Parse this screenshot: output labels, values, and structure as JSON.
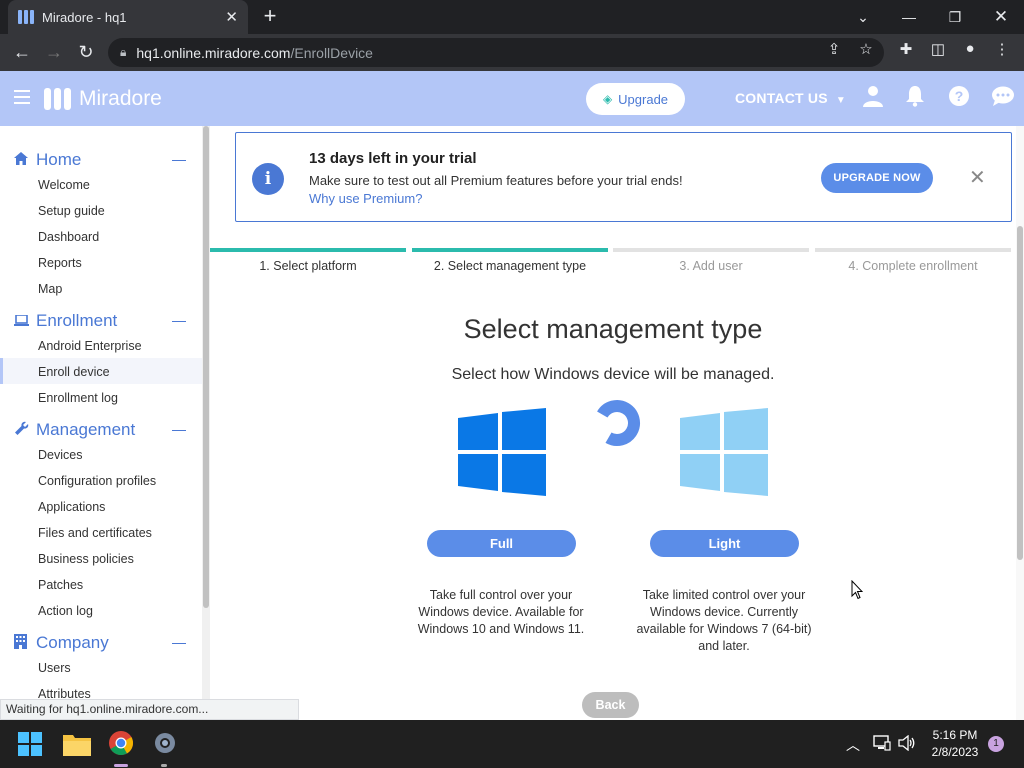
{
  "browser": {
    "tab_title": "Miradore - hq1",
    "url_host": "hq1.online.miradore.com",
    "url_path": "/EnrollDevice",
    "status_text": "Waiting for hq1.online.miradore.com..."
  },
  "header": {
    "brand": "Miradore",
    "upgrade_label": "Upgrade",
    "contact_label": "CONTACT US"
  },
  "sidebar": {
    "sections": [
      {
        "label": "Home",
        "icon": "home-icon",
        "items": [
          "Welcome",
          "Setup guide",
          "Dashboard",
          "Reports",
          "Map"
        ]
      },
      {
        "label": "Enrollment",
        "icon": "laptop-icon",
        "items": [
          "Android Enterprise",
          "Enroll device",
          "Enrollment log"
        ]
      },
      {
        "label": "Management",
        "icon": "wrench-icon",
        "items": [
          "Devices",
          "Configuration profiles",
          "Applications",
          "Files and certificates",
          "Business policies",
          "Patches",
          "Action log"
        ]
      },
      {
        "label": "Company",
        "icon": "building-icon",
        "items": [
          "Users",
          "Attributes"
        ]
      }
    ],
    "active_item": "Enroll device"
  },
  "trial": {
    "title": "13 days left in your trial",
    "text": "Make sure to test out all Premium features before your trial ends!",
    "link": "Why use Premium?",
    "button": "UPGRADE NOW"
  },
  "steps": [
    {
      "label": "1. Select platform",
      "state": "done"
    },
    {
      "label": "2. Select management type",
      "state": "done"
    },
    {
      "label": "3. Add user",
      "state": "todo"
    },
    {
      "label": "4. Complete enrollment",
      "state": "todo"
    }
  ],
  "content": {
    "heading": "Select management type",
    "subheading": "Select how Windows device will be managed.",
    "full_label": "Full",
    "full_desc_1": "Take full control over your",
    "full_desc_2": "Windows device. Available for",
    "full_desc_3": "Windows 10 and Windows 11.",
    "light_label": "Light",
    "light_desc_1": "Take limited control over your",
    "light_desc_2": "Windows device. Currently",
    "light_desc_3": "available for Windows 7 (64-bit)",
    "light_desc_4": "and later.",
    "back_label": "Back"
  },
  "taskbar": {
    "time": "5:16 PM",
    "date": "2/8/2023",
    "notification_count": "1"
  },
  "colors": {
    "accent": "#4a78d4",
    "header_bg": "#b3c6f7",
    "step_done": "#2bbbad",
    "button": "#5b8de8"
  }
}
